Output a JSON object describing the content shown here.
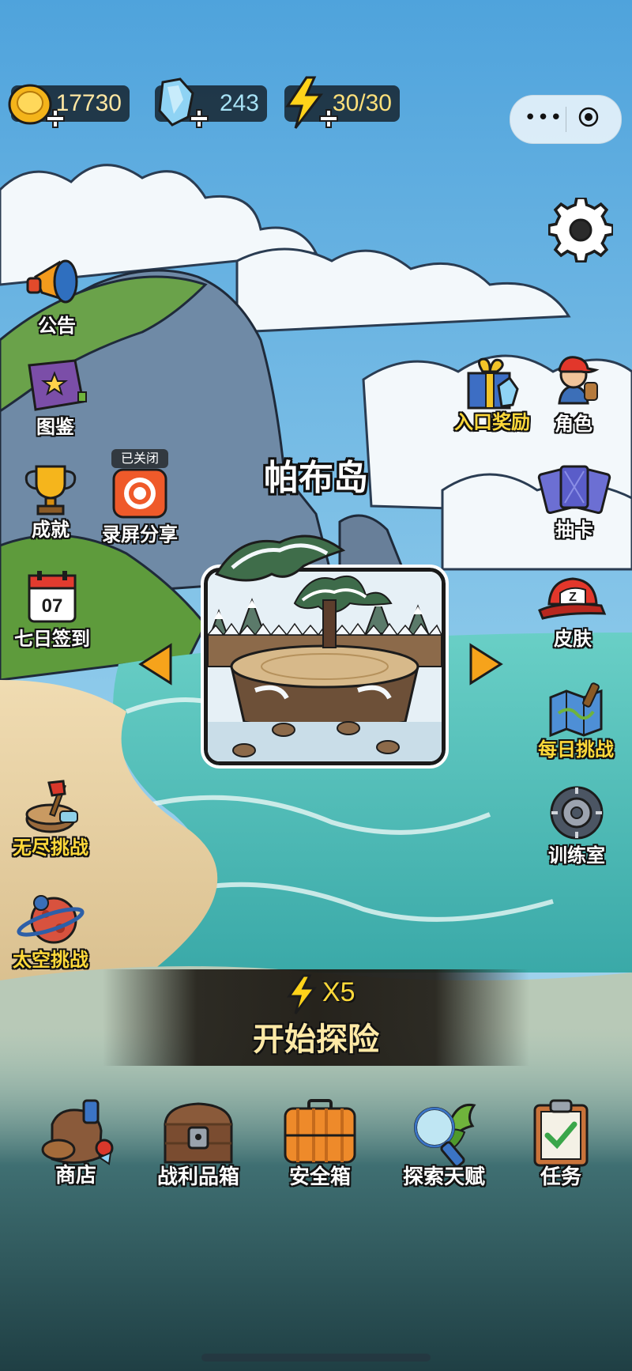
{
  "resources": {
    "coins": "17730",
    "gems": "243",
    "energy": "30/30"
  },
  "colors": {
    "sky_top": "#5aa9df",
    "sea": "#57c6c2",
    "sand": "#e9d4a8",
    "accent_yellow": "#ffd93a",
    "arrow_orange": "#f6a31b"
  },
  "left_menu": {
    "notice": "公告",
    "codex": "图鉴",
    "achievement": "成就",
    "record_share": "录屏分享",
    "record_badge": "已关闭",
    "seven_day": "七日签到",
    "calendar_day": "07",
    "endless": "无尽挑战",
    "space": "太空挑战"
  },
  "right_menu": {
    "entry_reward": "入口奖励",
    "character": "角色",
    "draw_card": "抽卡",
    "skin": "皮肤",
    "daily_challenge": "每日挑战",
    "training": "训练室"
  },
  "level": {
    "island_name": "帕布岛"
  },
  "start": {
    "cost": "X5",
    "label": "开始探险"
  },
  "bottom_menu": {
    "shop": "商店",
    "loot_box": "战利品箱",
    "safe_box": "安全箱",
    "talent": "探索天赋",
    "task": "任务"
  },
  "icons": [
    "coin-icon",
    "gem-icon",
    "energy-icon",
    "more-icon",
    "target-icon",
    "gear-icon",
    "megaphone-icon",
    "book-icon",
    "trophy-icon",
    "record-icon",
    "calendar-icon",
    "gift-icon",
    "character-icon",
    "cards-icon",
    "cap-icon",
    "map-icon",
    "tire-icon",
    "axe-stump-icon",
    "planet-icon",
    "left-arrow-icon",
    "right-arrow-icon",
    "backpack-icon",
    "chest-icon",
    "suitcase-icon",
    "magnifier-icon",
    "clipboard-icon"
  ]
}
